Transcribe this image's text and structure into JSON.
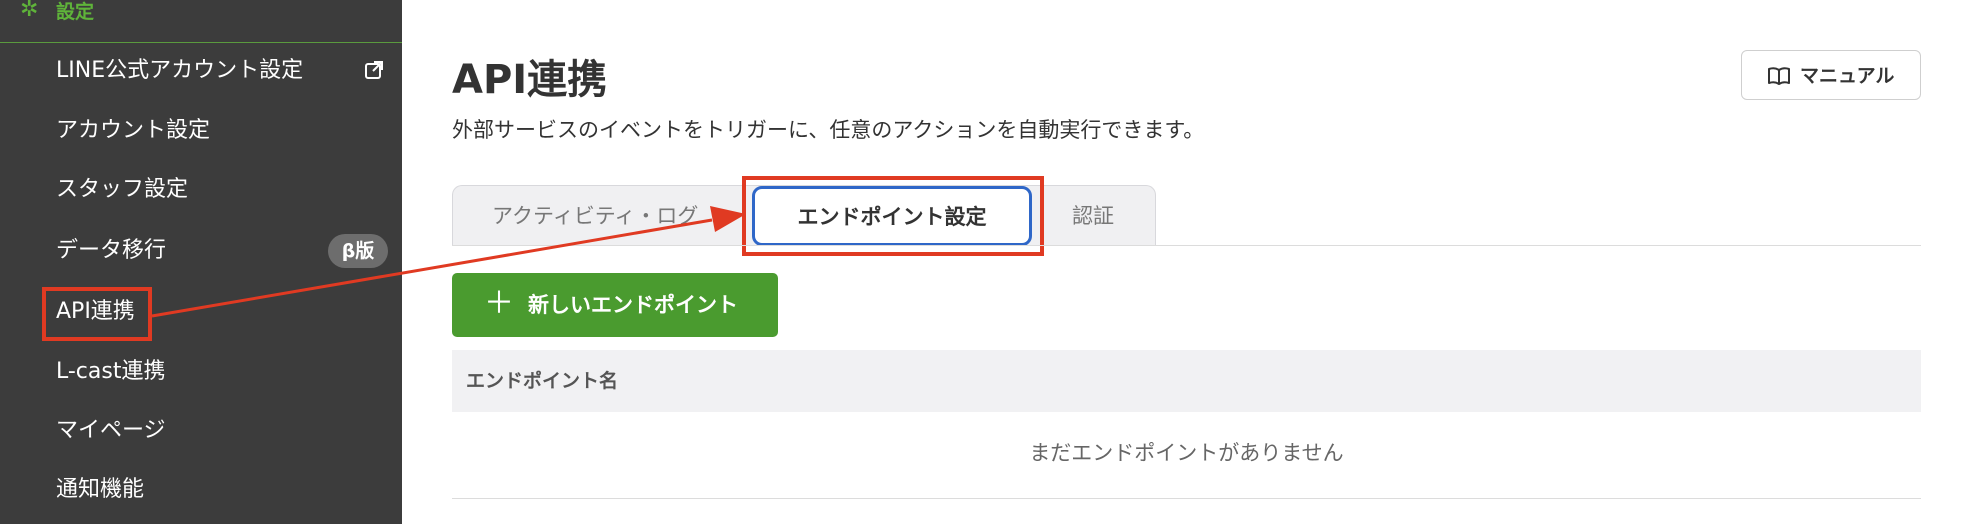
{
  "sidebar": {
    "section_label": "設定",
    "items": [
      {
        "label": "LINE公式アカウント設定"
      },
      {
        "label": "アカウント設定"
      },
      {
        "label": "スタッフ設定"
      },
      {
        "label": "データ移行",
        "badge": "β版"
      },
      {
        "label": "API連携"
      },
      {
        "label": "L-cast連携"
      },
      {
        "label": "マイページ"
      },
      {
        "label": "通知機能"
      }
    ]
  },
  "header": {
    "title": "API連携",
    "description": "外部サービスのイベントをトリガーに、任意のアクションを自動実行できます。",
    "manual_label": "マニュアル"
  },
  "tabs": [
    {
      "label": "アクティビティ・ログ"
    },
    {
      "label": "エンドポイント設定",
      "active": true
    },
    {
      "label": "認証"
    }
  ],
  "new_button_label": "新しいエンドポイント",
  "table": {
    "column_header": "エンドポイント名",
    "empty_text": "まだエンドポイントがありません"
  },
  "colors": {
    "sidebar_bg": "#3c3c3c",
    "accent_green": "#4a9b2f",
    "highlight_red": "#e03a22",
    "active_tab_border": "#2f67c8"
  },
  "icons": [
    "gear-icon",
    "external-link-icon",
    "book-icon",
    "plus-icon"
  ]
}
